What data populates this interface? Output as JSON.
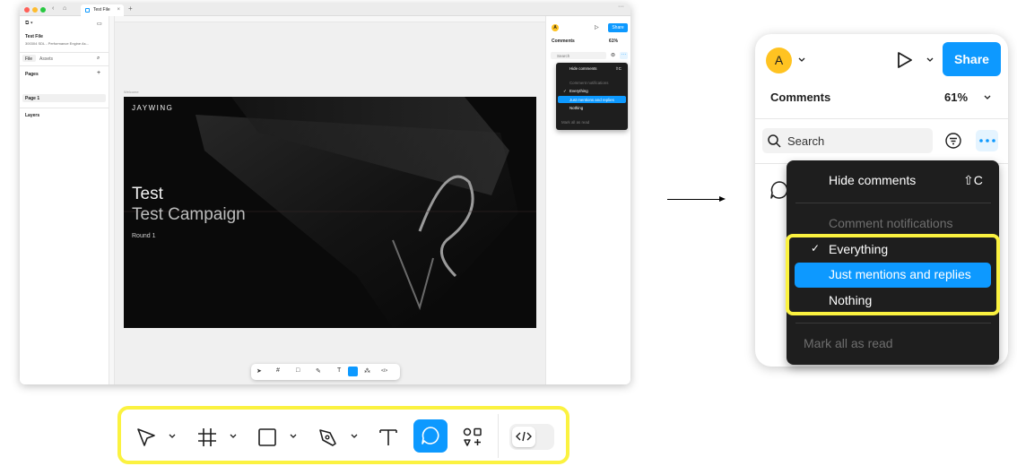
{
  "window": {
    "tab_title": "Test File",
    "file_title": "Test File",
    "file_subtitle": "300304 SDL - Performance Engine As...",
    "left_tabs": [
      "File",
      "Assets"
    ],
    "pages_heading": "Pages",
    "page_item": "Page 1",
    "layers_heading": "Layers",
    "frame_label": "Welcome",
    "frame": {
      "brand": "JAYWING",
      "title": "Test",
      "subtitle": "Test Campaign",
      "round": "Round 1"
    },
    "help_label": "?",
    "right_panel": {
      "avatar": "A",
      "share": "Share",
      "comments": "Comments",
      "zoom": "61%",
      "search_placeholder": "Search"
    },
    "menu": {
      "hide_comments": "Hide comments",
      "hide_shortcut": "⇧C",
      "notifications_heading": "Comment notifications",
      "everything": "Everything",
      "just_mentions": "Just mentions and replies",
      "nothing": "Nothing",
      "mark_all_read": "Mark all as read"
    }
  },
  "zoomed_panel": {
    "avatar": "A",
    "share": "Share",
    "comments": "Comments",
    "zoom": "61%",
    "search_placeholder": "Search",
    "menu": {
      "hide_comments": "Hide comments",
      "hide_shortcut": "⇧C",
      "notifications_heading": "Comment notifications",
      "everything": "Everything",
      "everything_check": "✓",
      "just_mentions": "Just mentions and replies",
      "nothing": "Nothing",
      "mark_all_read": "Mark all as read"
    }
  },
  "toolbar_tools": [
    "move-tool",
    "frame-tool",
    "shape-tool",
    "pen-tool",
    "text-tool",
    "comment-tool",
    "resources-tool",
    "dev-mode-toggle"
  ],
  "active_tool": "comment-tool",
  "colors": {
    "accent": "#0d99ff",
    "highlight_outline": "#fbf240",
    "menu_bg": "#1e1e1e",
    "avatar": "#ffc321"
  }
}
